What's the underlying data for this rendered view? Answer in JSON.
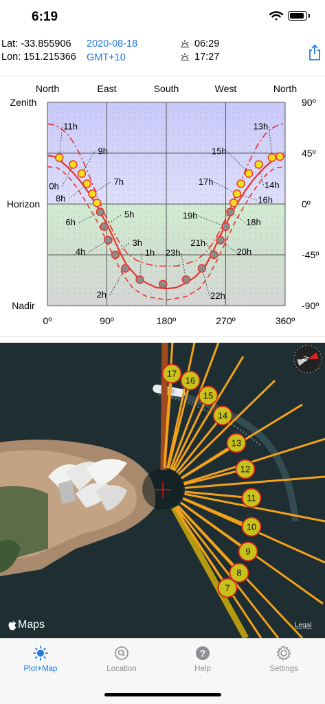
{
  "status_bar": {
    "time": "6:19"
  },
  "location": {
    "lat_label": "Lat: -33.855906",
    "lon_label": "Lon: 151.215366",
    "date": "2020-08-18",
    "timezone": "GMT+10",
    "sunrise": "06:29",
    "sunset": "17:27"
  },
  "chart_data": {
    "type": "line",
    "top_labels": [
      "North",
      "East",
      "South",
      "West",
      "North"
    ],
    "left_labels": [
      "Zenith",
      "Horizon",
      "Nadir"
    ],
    "right_labels": [
      "90º",
      "45º",
      "0º",
      "-45º",
      "-90º"
    ],
    "bottom_labels": [
      "0º",
      "90º",
      "180º",
      "270º",
      "360º"
    ],
    "xlim": [
      0,
      360
    ],
    "ylim": [
      -90,
      90
    ],
    "grid": true,
    "series": [
      {
        "style": "solid",
        "points": [
          [
            0,
            43
          ],
          [
            10,
            42
          ],
          [
            20,
            38
          ],
          [
            30,
            33
          ],
          [
            40,
            27
          ],
          [
            50,
            20
          ],
          [
            60,
            12
          ],
          [
            70,
            3
          ],
          [
            80,
            -7
          ],
          [
            90,
            -18
          ],
          [
            100,
            -30
          ],
          [
            110,
            -43
          ],
          [
            120,
            -54
          ],
          [
            135,
            -64
          ],
          [
            150,
            -70
          ],
          [
            165,
            -74
          ],
          [
            180,
            -75
          ],
          [
            195,
            -74
          ],
          [
            210,
            -70
          ],
          [
            225,
            -64
          ],
          [
            240,
            -54
          ],
          [
            250,
            -43
          ],
          [
            260,
            -30
          ],
          [
            270,
            -18
          ],
          [
            280,
            -7
          ],
          [
            290,
            3
          ],
          [
            300,
            12
          ],
          [
            310,
            20
          ],
          [
            320,
            27
          ],
          [
            330,
            33
          ],
          [
            340,
            38
          ],
          [
            350,
            42
          ],
          [
            360,
            43
          ]
        ]
      },
      {
        "style": "dashed",
        "points": [
          [
            0,
            33
          ],
          [
            15,
            32
          ],
          [
            25,
            28
          ],
          [
            35,
            22
          ],
          [
            45,
            14
          ],
          [
            55,
            5
          ],
          [
            65,
            -5
          ],
          [
            75,
            -15
          ],
          [
            85,
            -27
          ],
          [
            95,
            -40
          ],
          [
            105,
            -52
          ],
          [
            115,
            -63
          ],
          [
            130,
            -75
          ],
          [
            150,
            -82
          ],
          [
            180,
            -85
          ],
          [
            210,
            -82
          ],
          [
            230,
            -75
          ],
          [
            245,
            -63
          ],
          [
            255,
            -52
          ],
          [
            265,
            -40
          ],
          [
            275,
            -27
          ],
          [
            285,
            -15
          ],
          [
            295,
            -5
          ],
          [
            305,
            5
          ],
          [
            315,
            14
          ],
          [
            325,
            22
          ],
          [
            335,
            28
          ],
          [
            345,
            32
          ],
          [
            360,
            33
          ]
        ]
      },
      {
        "style": "dashdot",
        "points": [
          [
            0,
            71
          ],
          [
            10,
            70
          ],
          [
            20,
            67
          ],
          [
            30,
            62
          ],
          [
            40,
            54
          ],
          [
            50,
            43
          ],
          [
            60,
            30
          ],
          [
            70,
            15
          ],
          [
            80,
            0
          ],
          [
            90,
            -13
          ],
          [
            100,
            -25
          ],
          [
            110,
            -35
          ],
          [
            120,
            -43
          ],
          [
            135,
            -50
          ],
          [
            150,
            -53
          ],
          [
            165,
            -55
          ],
          [
            180,
            -55
          ],
          [
            195,
            -55
          ],
          [
            210,
            -53
          ],
          [
            225,
            -50
          ],
          [
            240,
            -43
          ],
          [
            250,
            -35
          ],
          [
            260,
            -25
          ],
          [
            270,
            -13
          ],
          [
            280,
            0
          ],
          [
            290,
            15
          ],
          [
            300,
            30
          ],
          [
            310,
            43
          ],
          [
            320,
            54
          ],
          [
            330,
            62
          ],
          [
            340,
            67
          ],
          [
            350,
            70
          ],
          [
            360,
            71
          ]
        ]
      }
    ],
    "sun_points": [
      {
        "az": 18,
        "el": 41,
        "up": true
      },
      {
        "az": 39,
        "el": 35,
        "up": true
      },
      {
        "az": 52,
        "el": 27,
        "up": true
      },
      {
        "az": 60,
        "el": 18,
        "up": true
      },
      {
        "az": 68,
        "el": 9,
        "up": true
      },
      {
        "az": 75,
        "el": 1,
        "up": true
      },
      {
        "az": 80,
        "el": -7,
        "up": false
      },
      {
        "az": 86,
        "el": -20,
        "up": false
      },
      {
        "az": 92,
        "el": -32,
        "up": false
      },
      {
        "az": 103,
        "el": -45,
        "up": false
      },
      {
        "az": 118,
        "el": -57,
        "up": false
      },
      {
        "az": 140,
        "el": -67,
        "up": false
      },
      {
        "az": 175,
        "el": -71,
        "up": false
      },
      {
        "az": 210,
        "el": -67,
        "up": false
      },
      {
        "az": 234,
        "el": -57,
        "up": false
      },
      {
        "az": 252,
        "el": -45,
        "up": false
      },
      {
        "az": 262,
        "el": -32,
        "up": false
      },
      {
        "az": 270,
        "el": -20,
        "up": false
      },
      {
        "az": 277,
        "el": -7,
        "up": false
      },
      {
        "az": 282,
        "el": 1,
        "up": true
      },
      {
        "az": 287,
        "el": 9,
        "up": true
      },
      {
        "az": 293,
        "el": 18,
        "up": true
      },
      {
        "az": 305,
        "el": 27,
        "up": true
      },
      {
        "az": 320,
        "el": 35,
        "up": true
      },
      {
        "az": 340,
        "el": 41,
        "up": true
      },
      {
        "az": 352,
        "el": 42,
        "up": true
      }
    ],
    "hour_labels": [
      {
        "text": "11h",
        "az": 35,
        "el": 66
      },
      {
        "text": "9h",
        "az": 84,
        "el": 44
      },
      {
        "text": "7h",
        "az": 108,
        "el": 17
      },
      {
        "text": "0h",
        "az": 10,
        "el": 13
      },
      {
        "text": "8h",
        "az": 20,
        "el": 2
      },
      {
        "text": "6h",
        "az": 35,
        "el": -19
      },
      {
        "text": "5h",
        "az": 124,
        "el": -12
      },
      {
        "text": "3h",
        "az": 136,
        "el": -37
      },
      {
        "text": "4h",
        "az": 50,
        "el": -45
      },
      {
        "text": "1h",
        "az": 155,
        "el": -46
      },
      {
        "text": "23h",
        "az": 190,
        "el": -46
      },
      {
        "text": "21h",
        "az": 228,
        "el": -37
      },
      {
        "text": "19h",
        "az": 216,
        "el": -13
      },
      {
        "text": "18h",
        "az": 312,
        "el": -19
      },
      {
        "text": "20h",
        "az": 298,
        "el": -45
      },
      {
        "text": "2h",
        "az": 82,
        "el": -83
      },
      {
        "text": "22h",
        "az": 258,
        "el": -84
      },
      {
        "text": "15h",
        "az": 260,
        "el": 44
      },
      {
        "text": "13h",
        "az": 323,
        "el": 66
      },
      {
        "text": "17h",
        "az": 240,
        "el": 17
      },
      {
        "text": "14h",
        "az": 340,
        "el": 14
      },
      {
        "text": "16h",
        "az": 330,
        "el": 1
      }
    ]
  },
  "map": {
    "hours": [
      "17",
      "16",
      "15",
      "14",
      "13",
      "12",
      "11",
      "10",
      "9",
      "8",
      "7"
    ],
    "logo": "Maps",
    "legal": "Legal",
    "compass": "N"
  },
  "tabs": [
    {
      "label": "Plot+Map",
      "icon": "sun-icon"
    },
    {
      "label": "Location",
      "icon": "search-icon"
    },
    {
      "label": "Help",
      "icon": "help-icon"
    },
    {
      "label": "Settings",
      "icon": "gear-icon"
    }
  ],
  "colors": {
    "accent": "#1e7ae0",
    "curve": "#e8322a",
    "sun_up": "#f5dc1e",
    "sun_down": "#8c8c8c",
    "ray": "#f3a21a"
  }
}
